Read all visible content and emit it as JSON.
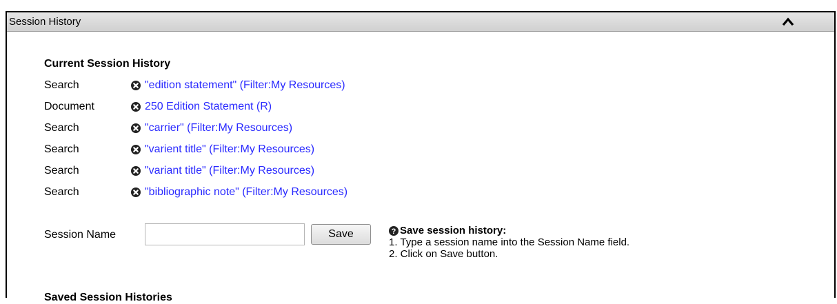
{
  "panel": {
    "title": "Session History",
    "collapse_icon": "chevron-up-icon"
  },
  "current": {
    "heading": "Current Session History",
    "items": [
      {
        "type": "Search",
        "label": "\"edition statement\" (Filter:My Resources)"
      },
      {
        "type": "Document",
        "label": "250 Edition Statement (R)"
      },
      {
        "type": "Search",
        "label": "\"carrier\" (Filter:My Resources)"
      },
      {
        "type": "Search",
        "label": "\"varient title\" (Filter:My Resources)"
      },
      {
        "type": "Search",
        "label": "\"variant title\" (Filter:My Resources)"
      },
      {
        "type": "Search",
        "label": "\"bibliographic note\" (Filter:My Resources)"
      }
    ]
  },
  "save_form": {
    "label": "Session Name",
    "input_value": "",
    "button_label": "Save"
  },
  "help": {
    "title": "Save session history:",
    "step1": "1. Type a session name into the Session Name field.",
    "step2": "2. Click on Save button."
  },
  "saved": {
    "heading": "Saved Session Histories"
  },
  "colors": {
    "link": "#2a2aff",
    "header_bg": "#d8d8d8"
  }
}
